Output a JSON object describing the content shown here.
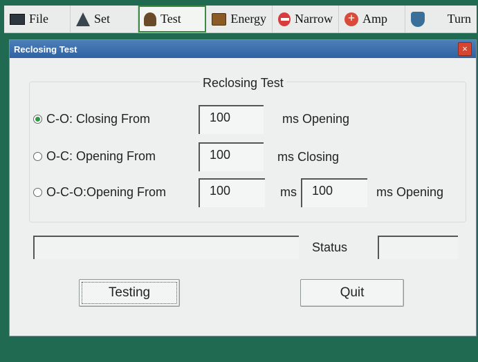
{
  "toolbar": {
    "items": [
      {
        "label": "File",
        "icon": "file-icon"
      },
      {
        "label": "Set",
        "icon": "set-icon"
      },
      {
        "label": "Test",
        "icon": "test-icon",
        "active": true
      },
      {
        "label": "Energy",
        "icon": "energy-icon"
      },
      {
        "label": "Narrow",
        "icon": "narrow-icon"
      },
      {
        "label": "Amp",
        "icon": "amp-icon"
      },
      {
        "label": "Turn",
        "icon": "turn-icon"
      }
    ]
  },
  "dialog": {
    "title": "Reclosing Test",
    "close_label": "×",
    "group_title": "Reclosing Test",
    "options": [
      {
        "label": "C-O: Closing From",
        "value": "100",
        "unit": "ms Opening",
        "checked": true
      },
      {
        "label": "O-C: Opening From",
        "value": "100",
        "unit": "ms Closing",
        "checked": false
      },
      {
        "label": "O-C-O:Opening From",
        "value": "100",
        "unit": "ms",
        "value2": "100",
        "unit2": "ms Opening",
        "checked": false
      }
    ],
    "status_label": "Status",
    "status_value": "",
    "progress_value": "",
    "testing_button": "Testing",
    "quit_button": "Quit"
  },
  "colors": {
    "background": "#1f6a50",
    "titlebar": "#3a6daa",
    "radio_checked": "#2f9a44",
    "close_button": "#d8452f"
  }
}
